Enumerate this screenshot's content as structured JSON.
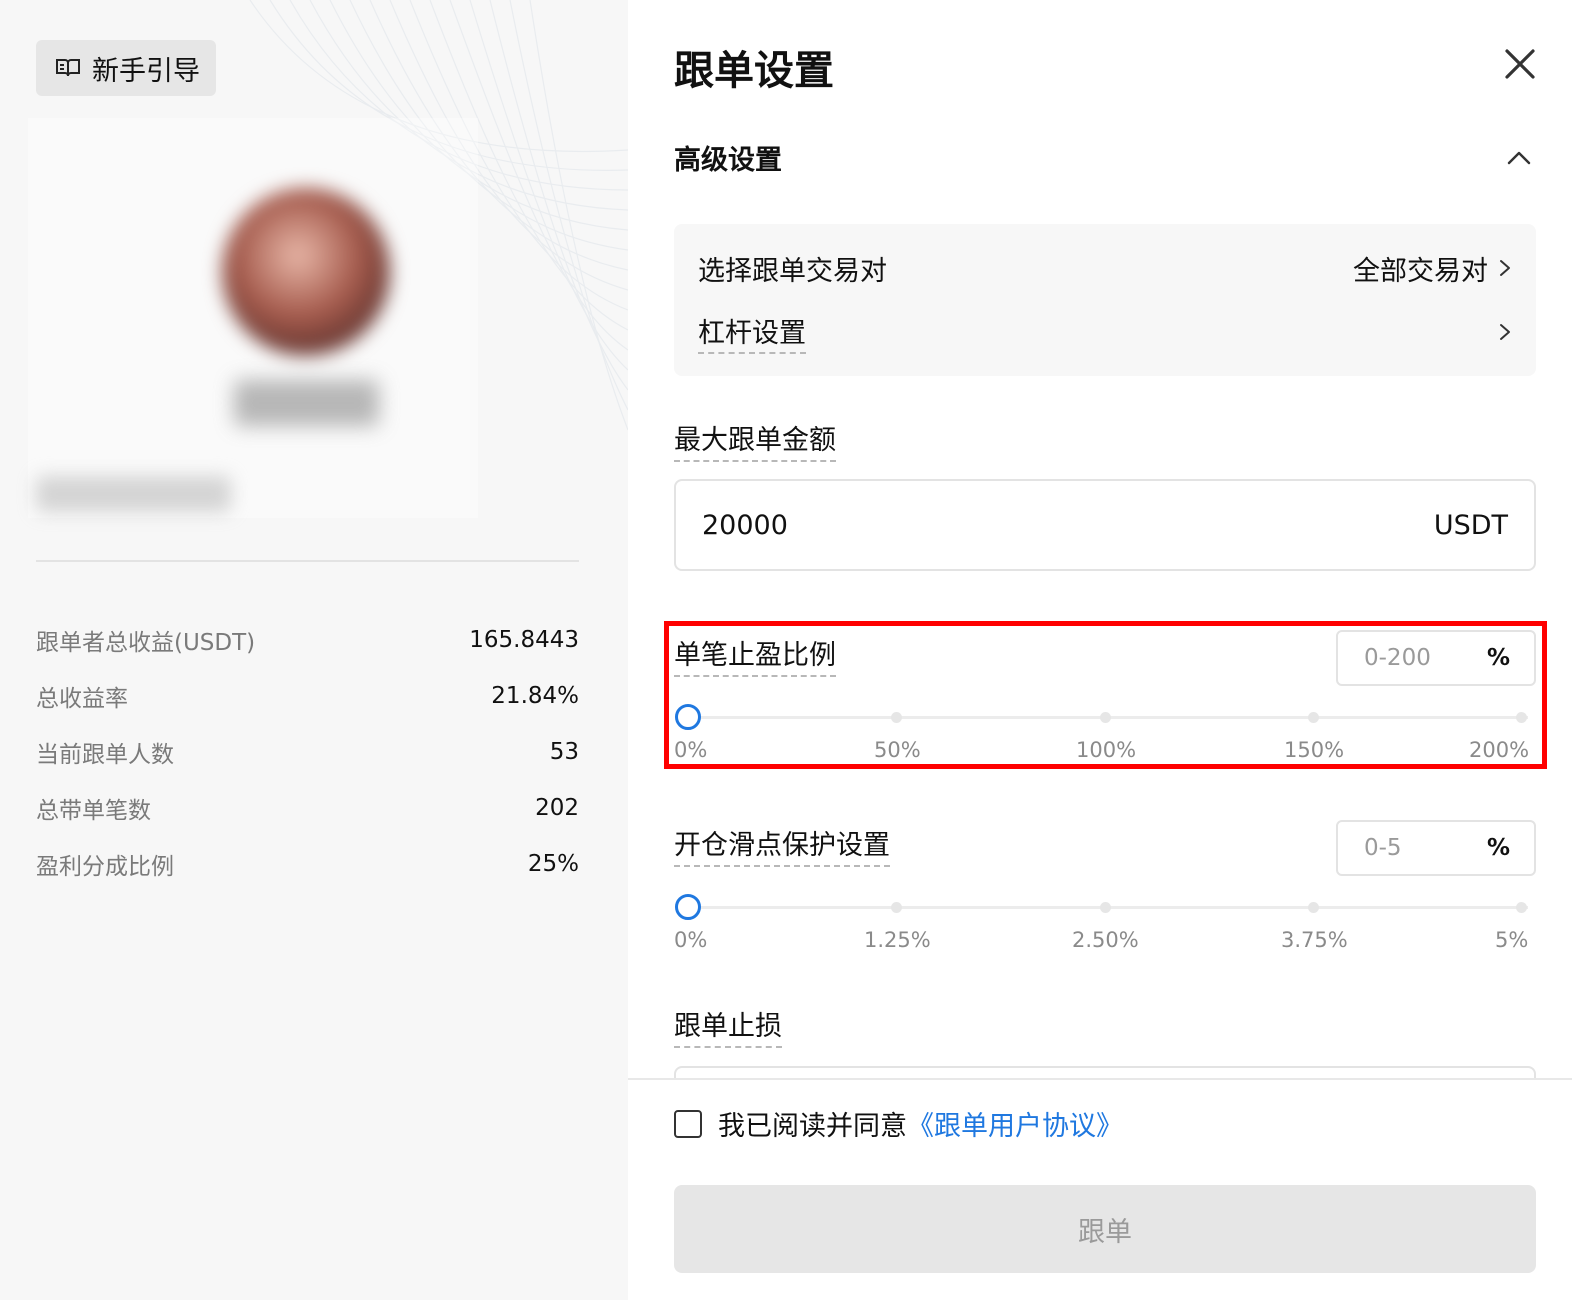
{
  "left": {
    "guide_button": {
      "label": "新手引导",
      "icon": "book-open-icon"
    },
    "stats": [
      {
        "label": "跟单者总收益(USDT)",
        "value": "165.8443"
      },
      {
        "label": "总收益率",
        "value": "21.84%"
      },
      {
        "label": "当前跟单人数",
        "value": "53"
      },
      {
        "label": "总带单笔数",
        "value": "202"
      },
      {
        "label": "盈利分成比例",
        "value": "25%"
      }
    ]
  },
  "panel": {
    "title": "跟单设置",
    "close_icon": "close-icon",
    "advanced": {
      "title": "高级设置",
      "toggle_icon": "chevron-up-icon",
      "pair_select_label": "选择跟单交易对",
      "pair_select_value": "全部交易对",
      "leverage_label": "杠杆设置"
    },
    "max_amount": {
      "label": "最大跟单金额",
      "value": "20000",
      "unit": "USDT"
    },
    "take_profit": {
      "label": "单笔止盈比例",
      "input_placeholder": "0-200",
      "unit": "%",
      "slider_value": 0,
      "ticks": [
        "0%",
        "50%",
        "100%",
        "150%",
        "200%"
      ]
    },
    "slippage": {
      "label": "开仓滑点保护设置",
      "input_placeholder": "0-5",
      "unit": "%",
      "slider_value": 0,
      "ticks": [
        "0%",
        "1.25%",
        "2.50%",
        "3.75%",
        "5%"
      ]
    },
    "stop_loss": {
      "label": "跟单止损"
    },
    "agreement": {
      "text": "我已阅读并同意",
      "link": "《跟单用户协议》",
      "checked": false
    },
    "submit_label": "跟单"
  },
  "colors": {
    "accent": "#1f78e0",
    "highlight": "#ff0000",
    "disabled_button": "#e6e6e6"
  }
}
